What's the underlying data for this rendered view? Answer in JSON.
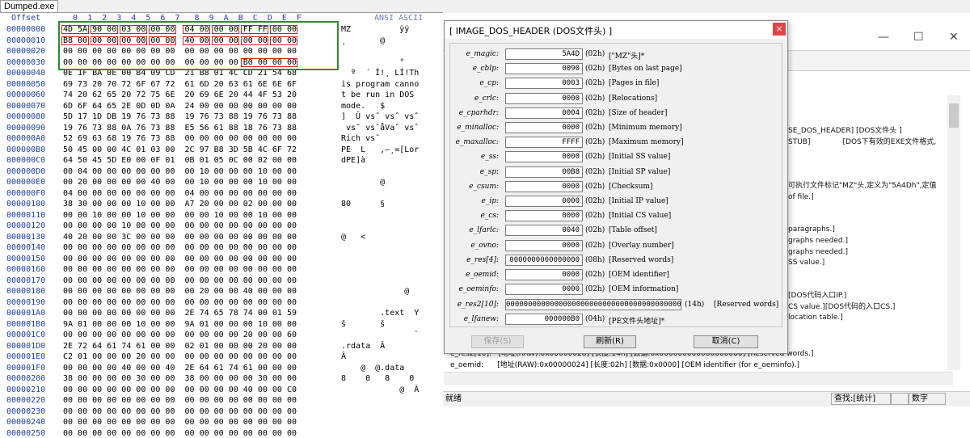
{
  "tab_title": "Dumped.exe",
  "hex": {
    "offset_header": "Offset",
    "col_header": " 0  1  2  3  4  5  6  7   8  9  A  B  C  D  E  F",
    "ascii_header": "ANSI ASCII",
    "rows": [
      {
        "off": "00000000",
        "bytes": "4D 5A 90 00 03 00 00 00  04 00 00 00 FF FF 00 00",
        "asc": "MZ          ÿÿ"
      },
      {
        "off": "00000010",
        "bytes": "B8 00 00 00 00 00 00 00  40 00 00 00 00 00 00 00",
        "asc": "¸       @"
      },
      {
        "off": "00000020",
        "bytes": "00 00 00 00 00 00 00 00  00 00 00 00 00 00 00 00",
        "asc": ""
      },
      {
        "off": "00000030",
        "bytes": "00 00 00 00 00 00 00 00  00 00 00 00 B0 00 00 00",
        "asc": "            °"
      },
      {
        "off": "00000040",
        "bytes": "0E 1F BA 0E 00 B4 09 CD  21 B8 01 4C CD 21 54 68",
        "asc": "  º  ´ Í!¸ LÍ!Th"
      },
      {
        "off": "00000050",
        "bytes": "69 73 20 70 72 6F 67 72  61 6D 20 63 61 6E 6E 6F",
        "asc": "is program canno"
      },
      {
        "off": "00000060",
        "bytes": "74 20 62 65 20 72 75 6E  20 69 6E 20 44 4F 53 20",
        "asc": "t be run in DOS"
      },
      {
        "off": "00000070",
        "bytes": "6D 6F 64 65 2E 0D 0D 0A  24 00 00 00 00 00 00 00",
        "asc": "mode.   $"
      },
      {
        "off": "00000080",
        "bytes": "5D 17 1D DB 19 76 73 88  19 76 73 88 19 76 73 88",
        "asc": "]  Û vsˆ vsˆ vsˆ"
      },
      {
        "off": "00000090",
        "bytes": "19 76 73 88 0A 76 73 88  E5 56 61 88 18 76 73 88",
        "asc": " vsˆ vsˆåVaˆ vsˆ"
      },
      {
        "off": "000000A0",
        "bytes": "52 69 63 68 19 76 73 88  00 00 00 00 00 00 00 00",
        "asc": "Rich vsˆ"
      },
      {
        "off": "000000B0",
        "bytes": "50 45 00 00 4C 01 03 00  2C 97 B8 3D 5B 4C 6F 72",
        "asc": "PE  L   ,—¸=[Lor"
      },
      {
        "off": "000000C0",
        "bytes": "64 50 45 5D E0 00 0F 01  0B 01 05 0C 00 02 00 00",
        "asc": "dPE]à"
      },
      {
        "off": "000000D0",
        "bytes": "00 04 00 00 00 00 00 00  00 10 00 00 00 10 00 00",
        "asc": ""
      },
      {
        "off": "000000E0",
        "bytes": "00 20 00 00 00 00 40 00  00 10 00 00 00 10 00 00",
        "asc": "        @"
      },
      {
        "off": "000000F0",
        "bytes": "04 00 00 00 00 00 00 00  04 00 00 00 00 00 00 00",
        "asc": ""
      },
      {
        "off": "00000100",
        "bytes": "38 30 00 00 00 10 00 00  A7 20 00 00 02 00 00 00",
        "asc": "80      §"
      },
      {
        "off": "00000110",
        "bytes": "00 00 10 00 00 10 00 00  00 00 10 00 00 10 00 00",
        "asc": ""
      },
      {
        "off": "00000120",
        "bytes": "00 00 00 00 10 00 00 00  00 00 00 00 00 00 00 00",
        "asc": ""
      },
      {
        "off": "00000130",
        "bytes": "40 20 00 00 3C 00 00 00  00 00 00 00 00 00 00 00",
        "asc": "@   <"
      },
      {
        "off": "00000140",
        "bytes": "00 00 00 00 00 00 00 00  00 00 00 00 00 00 00 00",
        "asc": ""
      },
      {
        "off": "00000150",
        "bytes": "00 00 00 00 00 00 00 00  00 00 00 00 00 00 00 00",
        "asc": ""
      },
      {
        "off": "00000160",
        "bytes": "00 00 00 00 00 00 00 00  00 00 00 00 00 00 00 00",
        "asc": ""
      },
      {
        "off": "00000170",
        "bytes": "00 00 00 00 00 00 00 00  00 00 00 00 00 00 00 00",
        "asc": ""
      },
      {
        "off": "00000180",
        "bytes": "00 00 00 00 00 00 00 00  00 20 00 00 40 00 00 00",
        "asc": "             @"
      },
      {
        "off": "00000190",
        "bytes": "00 00 00 00 00 00 00 00  00 00 00 00 00 00 00 00",
        "asc": ""
      },
      {
        "off": "000001A0",
        "bytes": "00 00 00 00 00 00 00 00  2E 74 65 78 74 00 01 59",
        "asc": "        .text  Y"
      },
      {
        "off": "000001B0",
        "bytes": "9A 01 00 00 00 10 00 00  9A 01 00 00 00 10 00 00",
        "asc": "š       š"
      },
      {
        "off": "000001C0",
        "bytes": "00 00 00 00 00 00 00 00  00 00 00 00 20 00 00 60",
        "asc": "               `"
      },
      {
        "off": "000001D0",
        "bytes": "2E 72 64 61 74 61 00 00  02 01 00 00 00 20 00 00",
        "asc": ".rdata  Â"
      },
      {
        "off": "000001E0",
        "bytes": "C2 01 00 00 00 20 00 00  00 00 00 00 00 00 00 00",
        "asc": "Â"
      },
      {
        "off": "000001F0",
        "bytes": "00 00 00 00 40 00 00 40  2E 64 61 74 61 00 00 00",
        "asc": "    @  @.data"
      },
      {
        "off": "00000200",
        "bytes": "38 00 00 00 00 30 00 00  38 00 00 00 00 30 00 00",
        "asc": "8    0   8    0"
      },
      {
        "off": "00000210",
        "bytes": "00 00 00 00 00 00 00 00  00 00 00 00 40 00 00 C0",
        "asc": "            @  À"
      },
      {
        "off": "00000220",
        "bytes": "00 00 00 00 00 00 00 00  00 00 00 00 00 00 00 00",
        "asc": ""
      },
      {
        "off": "00000230",
        "bytes": "00 00 00 00 00 00 00 00  00 00 00 00 00 00 00 00",
        "asc": ""
      },
      {
        "off": "00000240",
        "bytes": "00 00 00 00 00 00 00 00  00 00 00 00 00 00 00 00",
        "asc": ""
      },
      {
        "off": "00000250",
        "bytes": "00 00 00 00 00 00 00 00  00 00 00 00 00 00 00 00",
        "asc": ""
      },
      {
        "off": "00000260",
        "bytes": "00 00 00 00 00 00 00 00  00 00 00 00 00 00 00 00",
        "asc": ""
      }
    ]
  },
  "dialog": {
    "title": "[ IMAGE_DOS_HEADER (DOS文件头) ]",
    "close": "×",
    "fields": [
      {
        "name": "e_magic:",
        "value": "5A4D",
        "size": "(02h)",
        "desc": "[\"MZ\"头]*"
      },
      {
        "name": "e_cblp:",
        "value": "0090",
        "size": "(02h)",
        "desc": "[Bytes on last page]"
      },
      {
        "name": "e_cp:",
        "value": "0003",
        "size": "(02h)",
        "desc": "[Pages in file]"
      },
      {
        "name": "e_crlc:",
        "value": "0000",
        "size": "(02h)",
        "desc": "[Relocations]"
      },
      {
        "name": "e_cparhdr:",
        "value": "0004",
        "size": "(02h)",
        "desc": "[Size of header]"
      },
      {
        "name": "e_minalloc:",
        "value": "0000",
        "size": "(02h)",
        "desc": "[Minimum memory]"
      },
      {
        "name": "e_maxalloc:",
        "value": "FFFF",
        "size": "(02h)",
        "desc": "[Maximum memory]"
      },
      {
        "name": "e_ss:",
        "value": "0000",
        "size": "(02h)",
        "desc": "[Initial SS value]"
      },
      {
        "name": "e_sp:",
        "value": "00B8",
        "size": "(02h)",
        "desc": "[Initial SP value]"
      },
      {
        "name": "e_csum:",
        "value": "0000",
        "size": "(02h)",
        "desc": "[Checksum]"
      },
      {
        "name": "e_ip:",
        "value": "0000",
        "size": "(02h)",
        "desc": "[Initial IP value]"
      },
      {
        "name": "e_cs:",
        "value": "0000",
        "size": "(02h)",
        "desc": "[Initial CS value]"
      },
      {
        "name": "e_lfarlc:",
        "value": "0040",
        "size": "(02h)",
        "desc": "[Table offset]"
      },
      {
        "name": "e_ovno:",
        "value": "0000",
        "size": "(02h)",
        "desc": "[Overlay number]"
      },
      {
        "name": "e_res[4]:",
        "value": "0000000000000000",
        "size": "(08h)",
        "desc": "[Reserved words]"
      },
      {
        "name": "e_oemid:",
        "value": "0000",
        "size": "(02h)",
        "desc": "[OEM identifier]"
      },
      {
        "name": "e_oeminfo:",
        "value": "0000",
        "size": "(02h)",
        "desc": "[OEM information]"
      }
    ],
    "res2": {
      "name": "e_res2[10]:",
      "value": "0000000000000000000000000000000000000000",
      "size": "(14h)",
      "desc": "[Reserved words]"
    },
    "lfanew": {
      "name": "e_lfanew:",
      "value": "000000B0",
      "size": "(04h)",
      "desc": "[PE文件头地址]*"
    },
    "buttons": {
      "save": "保存(S)",
      "refresh": "刷新(R)",
      "cancel": "取消(C)"
    }
  },
  "right_panel": {
    "window_buttons": {
      "minimize": "—",
      "maximize": "☐",
      "close": "✕"
    },
    "lines": [
      "SE_DOS_HEADER] [DOS文件头 ]",
      "STUB]              [DOS下有效的EXE文件格式,",
      "",
      "",
      "",
      "可执行文件标记\"MZ\"头,定义为\"5A4Dh\",定值",
      "of file.]",
      "",
      "",
      "paragraphs.]",
      "graphs needed.]",
      "graphs needed.]",
      "SS value.]",
      "",
      "",
      "[DOS代码入口IP.]",
      "CS value.][DOS代码的入口CS.]",
      "location table.]"
    ],
    "bottom_lines": [
      "e_res2[10]:   [地址(RAW):0x00000028] [长度:14h] [数据:0x000000000000000000] [Reserved words.]",
      "e_oemid:      [地址(RAW):0x00000024] [长度:02h] [数据:0x0000] [OEM identifier (for e_oeminfo).]"
    ]
  },
  "status": {
    "ready": "就绪",
    "find": "查找:[统计]",
    "numlock": "数字"
  }
}
